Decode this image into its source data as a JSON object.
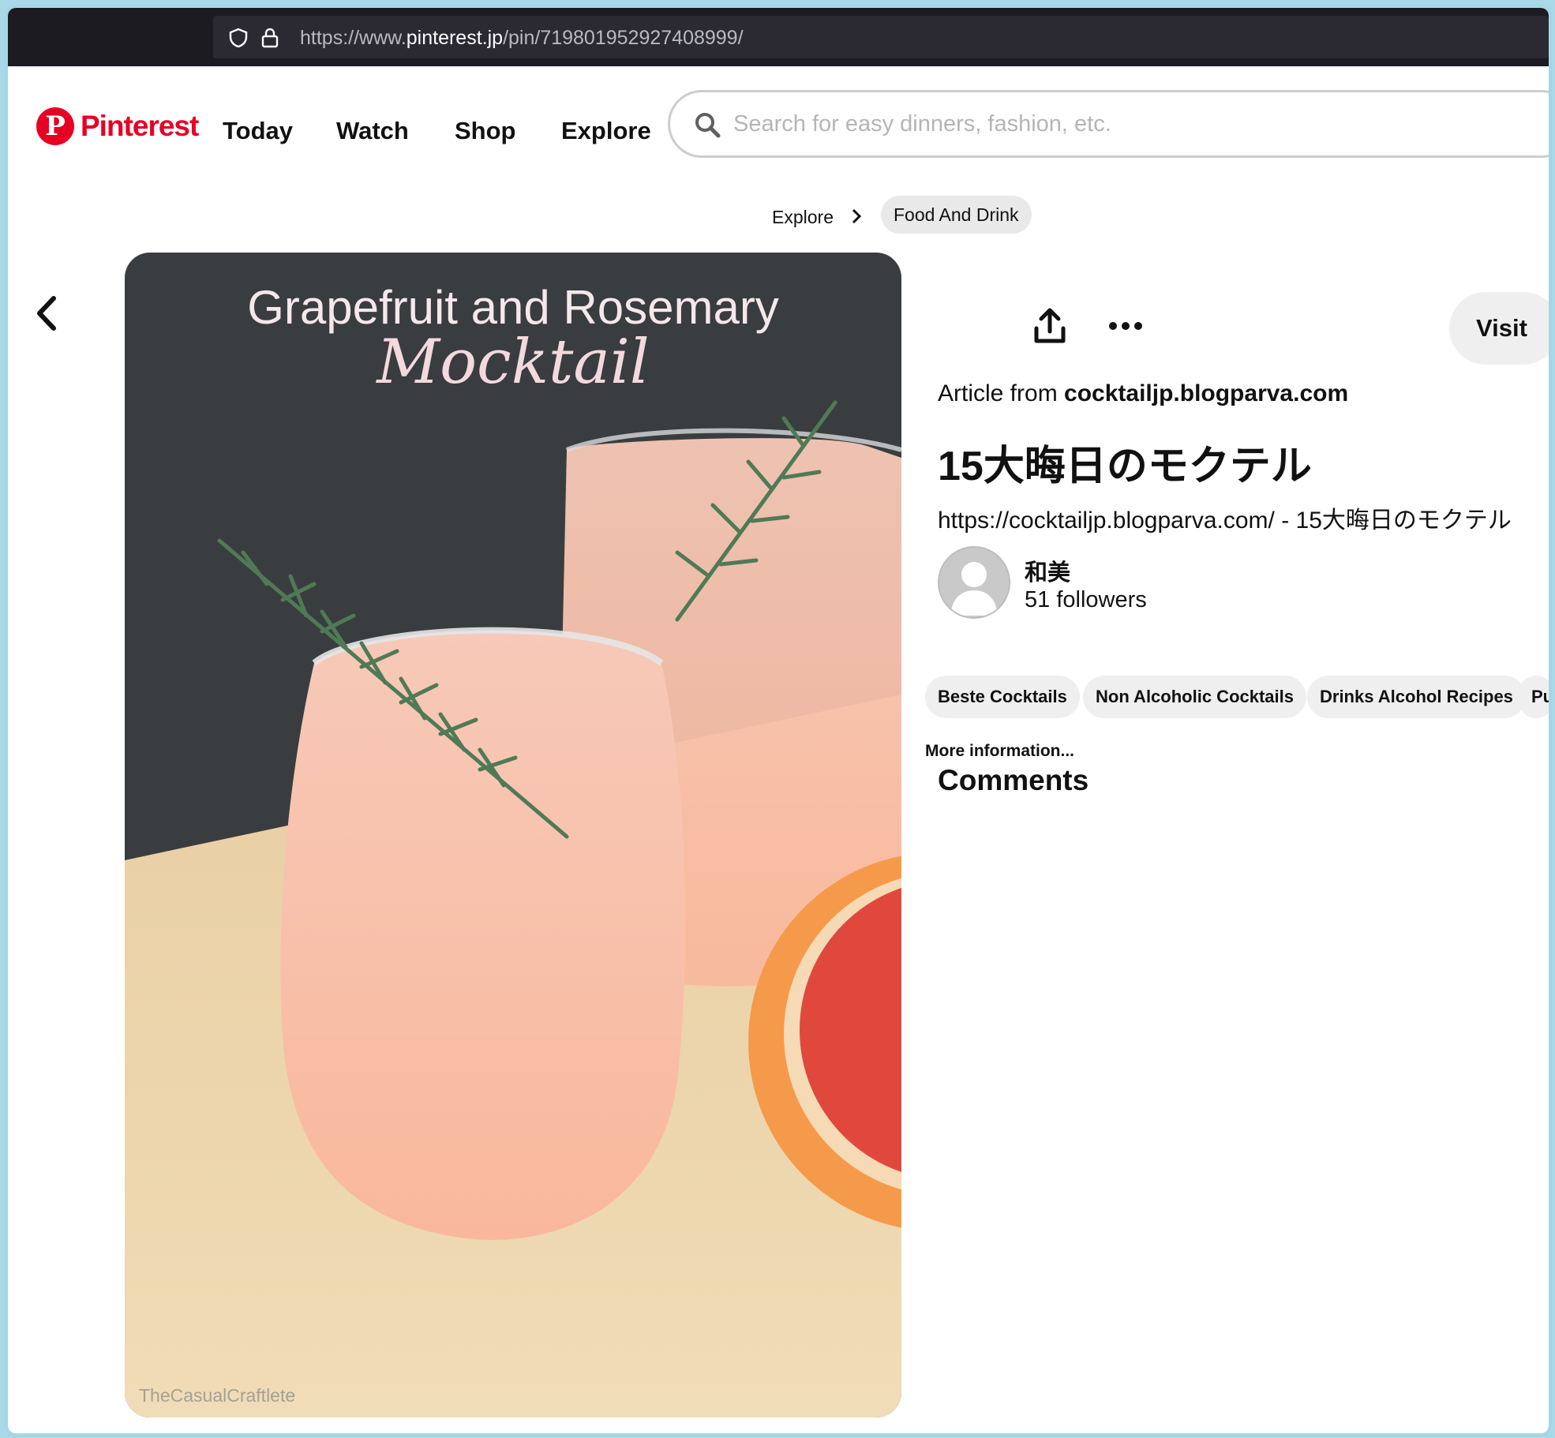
{
  "browser": {
    "url_prefix": "https://www.",
    "url_host": "pinterest.jp",
    "url_path": "/pin/719801952927408999/"
  },
  "header": {
    "logo_text": "Pinterest",
    "nav": [
      "Today",
      "Watch",
      "Shop",
      "Explore"
    ],
    "search_placeholder": "Search for easy dinners, fashion, etc."
  },
  "breadcrumb": {
    "root": "Explore",
    "current": "Food And Drink"
  },
  "pin": {
    "image_title_line1": "Grapefruit and Rosemary",
    "image_title_line2": "Mocktail",
    "watermark": "TheCasualCraftlete",
    "visit_label": "Visit",
    "article_prefix": "Article from",
    "article_source": "cocktailjp.blogparva.com",
    "title": "15大晦日のモクテル",
    "description": "https://cocktailjp.blogparva.com/ - 15大晦日のモクテル",
    "user_name": "和美",
    "followers": "51 followers",
    "tags": [
      "Beste Cocktails",
      "Non Alcoholic Cocktails",
      "Drinks Alcohol Recipes",
      "Pu"
    ],
    "more_info": "More information...",
    "comments_heading": "Comments"
  },
  "icons": [
    "shield-icon",
    "lock-icon",
    "search-icon",
    "chevron-right-icon",
    "back-arrow-icon",
    "share-icon",
    "more-options-icon",
    "avatar-placeholder-icon"
  ],
  "colors": {
    "brand": "#e60023",
    "browser_bar": "#1c1b22",
    "pill_bg": "#efefef"
  }
}
